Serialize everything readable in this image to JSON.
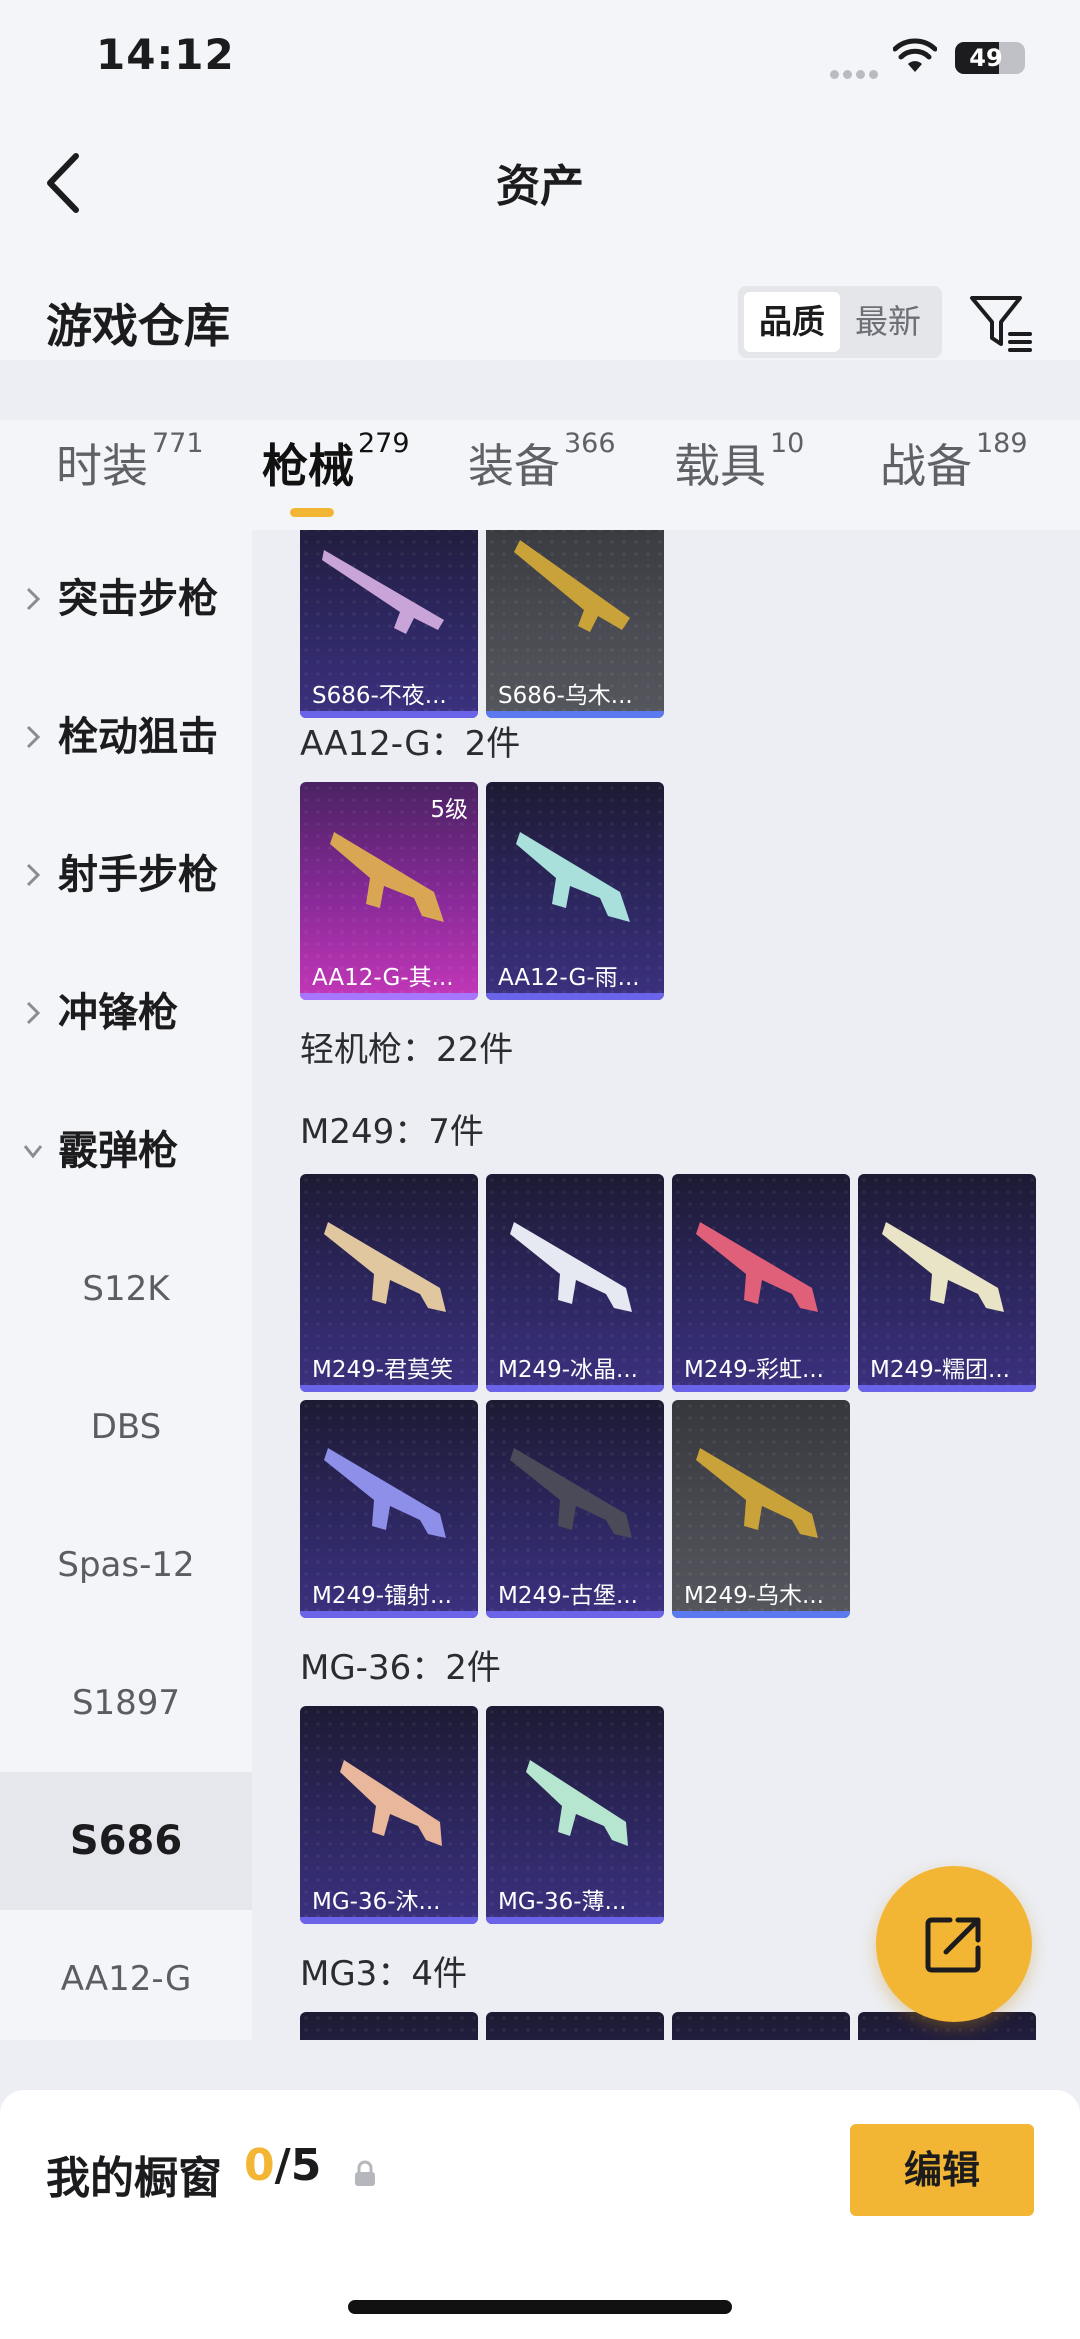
{
  "status_bar": {
    "time": "14:12",
    "battery": "49"
  },
  "header": {
    "title": "资产",
    "section_title": "游戏仓库",
    "sort_options": [
      "品质",
      "最新"
    ]
  },
  "tabs": [
    {
      "label": "时装",
      "count": "771"
    },
    {
      "label": "枪械",
      "count": "279"
    },
    {
      "label": "装备",
      "count": "366"
    },
    {
      "label": "载具",
      "count": "10"
    },
    {
      "label": "战备",
      "count": "189"
    }
  ],
  "sidebar": {
    "categories": [
      "突击步枪",
      "栓动狙击",
      "射手步枪",
      "冲锋枪",
      "霰弹枪"
    ],
    "subitems": [
      "S12K",
      "DBS",
      "Spas-12",
      "S1897",
      "S686",
      "AA12-G"
    ],
    "selected": "S686"
  },
  "content": {
    "top_cards": [
      "S686-不夜...",
      "S686-乌木..."
    ],
    "groups": [
      {
        "title": "AA12-G：2件",
        "items": [
          {
            "name": "AA12-G-其...",
            "level": "5级"
          },
          {
            "name": "AA12-G-雨..."
          }
        ]
      },
      {
        "title": "轻机枪：22件"
      },
      {
        "title": "M249：7件",
        "items": [
          {
            "name": "M249-君莫笑"
          },
          {
            "name": "M249-冰晶..."
          },
          {
            "name": "M249-彩虹..."
          },
          {
            "name": "M249-糯团..."
          },
          {
            "name": "M249-镭射..."
          },
          {
            "name": "M249-古堡..."
          },
          {
            "name": "M249-乌木..."
          }
        ]
      },
      {
        "title": "MG-36：2件",
        "items": [
          {
            "name": "MG-36-沐..."
          },
          {
            "name": "MG-36-薄..."
          }
        ]
      },
      {
        "title": "MG3：4件"
      }
    ]
  },
  "bottom_bar": {
    "title": "我的橱窗",
    "current": "0",
    "total": "/5",
    "edit_label": "编辑"
  },
  "colors": {
    "accent": "#f2b634",
    "card_purple": "#2d2760",
    "card_grey": "#4b4c53",
    "card_pink": "#8a2a9a"
  }
}
